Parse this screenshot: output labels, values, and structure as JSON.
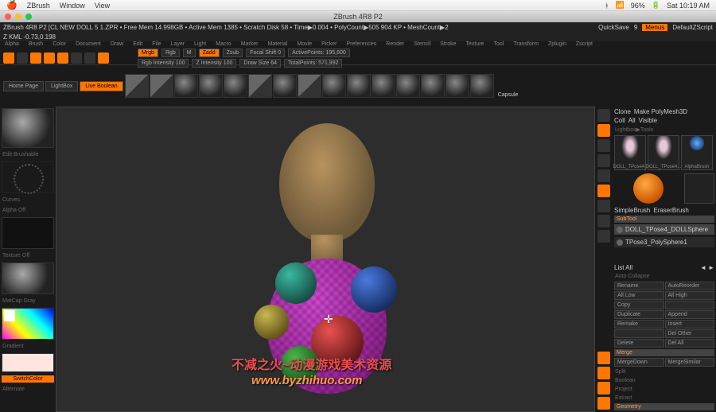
{
  "mac": {
    "app": "ZBrush",
    "menus": [
      "Window",
      "View"
    ],
    "right": [
      "96%",
      "Sat 10:19 AM"
    ]
  },
  "window_title": "ZBrush 4R8 P2",
  "status": {
    "left": "ZBrush 4R8 P2 [CL NEW DOLL 5 1.ZPR    • Free Mem 14.998GB • Active Mem 1385 • Scratch Disk 58 • Time▶0.004 • PolyCount▶505 904 KP • MeshCount▶2",
    "coords": "Z KML -0.73,0.198",
    "quicksave": "QuickSave",
    "qs_num": "9",
    "menu_btn": "Menus",
    "project": "DefaultZScript"
  },
  "menus": [
    "Alpha",
    "Brush",
    "Color",
    "Document",
    "Draw",
    "Edit",
    "File",
    "Layer",
    "Light",
    "Macro",
    "Marker",
    "Material",
    "Movie",
    "Picker",
    "Preferences",
    "Render",
    "Stencil",
    "Stroke",
    "Texture",
    "Tool",
    "Transform",
    "Zplugin",
    "Zscript"
  ],
  "tabs": [
    "Home Page",
    "LightBox",
    "Live Boolean"
  ],
  "draw_params": {
    "mrgb": "Mrgb",
    "rgb": "Rgb",
    "m": "M",
    "zadd": "Zadd",
    "zsub": "Zsub",
    "rgb_intensity": "Rgb Intensity 100",
    "z_intensity": "Z Intensity 100",
    "focal": "Focal Shift 0",
    "draw_size": "Draw Size 64",
    "active": "ActivePoints: 195,600",
    "total": "TotalPoints: 571,992",
    "capsule": "Capsule"
  },
  "left": {
    "edit": "Edit Brushable",
    "curves": "Curves",
    "alpha": "Alpha Off",
    "texture": "Texture Off",
    "material": "MatCap Gray",
    "gradient": "Gradient",
    "switch": "SwitchColor",
    "alternate": "Alternate"
  },
  "right": {
    "header": [
      "Clone",
      "Make PolyMesh3D"
    ],
    "header2": [
      "Coll",
      "All",
      "Visible"
    ],
    "lightbox": "Lightbox▶Tools",
    "tools": [
      "DOLL_TPose4_",
      "DOLL_TPose4..."
    ],
    "brushes": [
      "SimpleBrush",
      "EraserBrush"
    ],
    "subtool": "SubTool",
    "current": "DOLL_TPose4_DOLLSphere",
    "items": [
      "TPose3_PolySphere1"
    ],
    "list_all": "List All",
    "auto": "Auto Collapse",
    "ops": [
      [
        "Rename",
        "AutoReorder"
      ],
      [
        "All Low",
        "All High"
      ],
      [
        "Copy",
        ""
      ],
      [
        "Duplicate",
        "Append"
      ],
      [
        "Remake",
        "Insert"
      ],
      [
        "",
        "Del Other"
      ],
      [
        "Delete",
        "Del All"
      ]
    ],
    "merge": "Merge",
    "md": "MergeDown",
    "ms": "MergeSimilar",
    "split": "Split",
    "bool": "Boolean",
    "proj": "Project",
    "extract": "Extract",
    "geom": "Geometry"
  },
  "watermark": {
    "line1": "不减之火~动漫游戏美术资源",
    "line2": "www.byzhihuo.com"
  }
}
